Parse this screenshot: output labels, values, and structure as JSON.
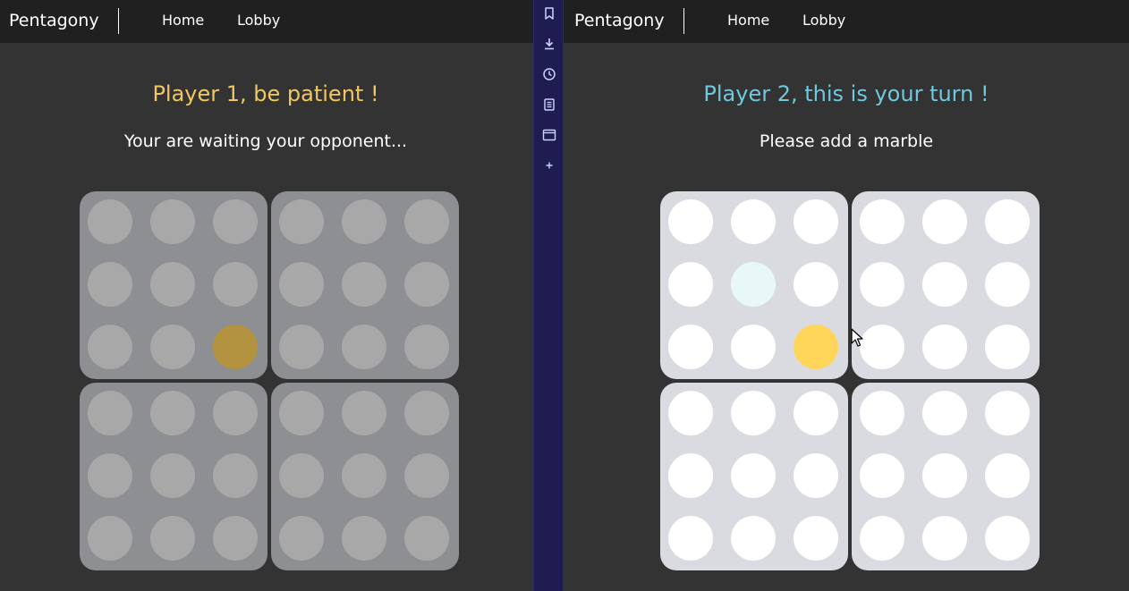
{
  "panes": {
    "left": {
      "brand": "Pentagony",
      "nav": {
        "home": "Home",
        "lobby": "Lobby"
      },
      "title": "Player 1, be patient !",
      "title_color": "#f1c761",
      "subtitle": "Your are waiting your opponent...",
      "board_state": "waiting",
      "board": [
        [
          "",
          "",
          "",
          "",
          "",
          ""
        ],
        [
          "",
          "",
          "",
          "",
          "",
          ""
        ],
        [
          "",
          "",
          "yellow",
          "",
          "",
          ""
        ],
        [
          "",
          "",
          "",
          "",
          "",
          ""
        ],
        [
          "",
          "",
          "",
          "",
          "",
          ""
        ],
        [
          "",
          "",
          "",
          "",
          "",
          ""
        ]
      ]
    },
    "right": {
      "brand": "Pentagony",
      "nav": {
        "home": "Home",
        "lobby": "Lobby"
      },
      "title": "Player 2, this is your turn !",
      "title_color": "#6dc9de",
      "subtitle": "Please add a marble",
      "board_state": "active",
      "board": [
        [
          "",
          "",
          "",
          "",
          "",
          ""
        ],
        [
          "",
          "hover",
          "",
          "",
          "",
          ""
        ],
        [
          "",
          "",
          "yellow",
          "",
          "",
          ""
        ],
        [
          "",
          "",
          "",
          "",
          "",
          ""
        ],
        [
          "",
          "",
          "",
          "",
          "",
          ""
        ],
        [
          "",
          "",
          "",
          "",
          "",
          ""
        ]
      ]
    }
  },
  "colors": {
    "background": "#333333",
    "navbar": "#202020",
    "sidebar": "#1e1c50",
    "marble_yellow": "#ffd659"
  },
  "sidebar_icons": [
    "bookmark-icon",
    "download-icon",
    "clock-icon",
    "notes-icon",
    "browser-window-icon",
    "plus-icon"
  ]
}
